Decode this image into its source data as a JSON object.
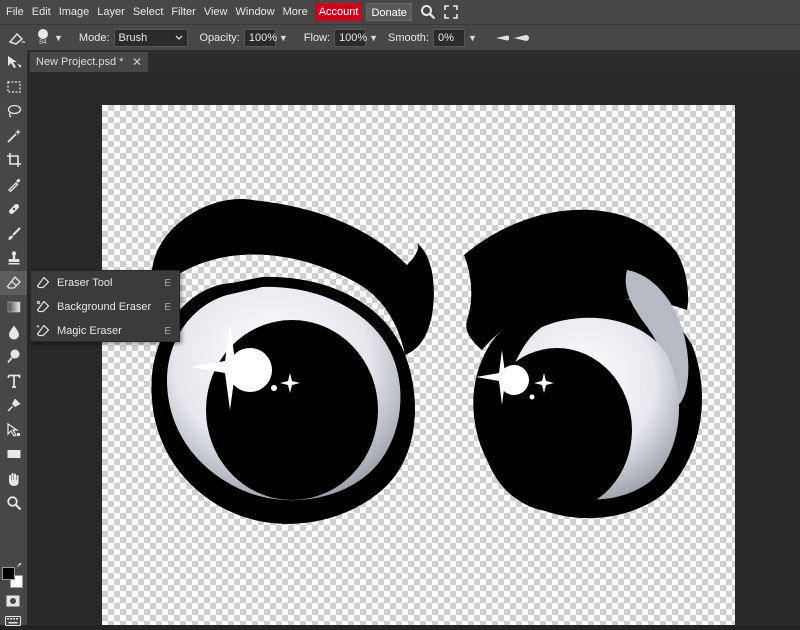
{
  "menubar": {
    "items": [
      "File",
      "Edit",
      "Image",
      "Layer",
      "Select",
      "Filter",
      "View",
      "Window",
      "More"
    ],
    "account": "Account",
    "donate": "Donate",
    "icons": [
      "search-icon",
      "fullscreen-icon"
    ]
  },
  "options": {
    "brush_size": "84",
    "mode_label": "Mode:",
    "mode_value": "Brush",
    "opacity_label": "Opacity:",
    "opacity_value": "100%",
    "flow_label": "Flow:",
    "flow_value": "100%",
    "smooth_label": "Smooth:",
    "smooth_value": "0%"
  },
  "document": {
    "tab_title": "New Project.psd *",
    "tab_close": "✕"
  },
  "toolbar": {
    "tools": [
      "move-tool-icon",
      "marquee-tool-icon",
      "lasso-tool-icon",
      "magic-wand-tool-icon",
      "crop-tool-icon",
      "eyedropper-tool-icon",
      "healing-tool-icon",
      "brush-tool-icon",
      "clone-stamp-tool-icon",
      "eraser-tool-icon",
      "gradient-tool-icon",
      "blur-tool-icon",
      "dodge-tool-icon",
      "type-tool-icon",
      "pen-tool-icon",
      "path-select-tool-icon",
      "shape-tool-icon",
      "hand-tool-icon",
      "zoom-tool-icon"
    ],
    "active_tool": "eraser-tool-icon",
    "foreground_color": "#000000",
    "background_color": "#ffffff"
  },
  "flyout": {
    "items": [
      {
        "label": "Eraser Tool",
        "key": "E"
      },
      {
        "label": "Background Eraser",
        "key": "E"
      },
      {
        "label": "Magic Eraser",
        "key": "E"
      }
    ]
  },
  "colors": {
    "accent_account": "#d0021b",
    "panel": "#474747",
    "workspace": "#282828"
  }
}
